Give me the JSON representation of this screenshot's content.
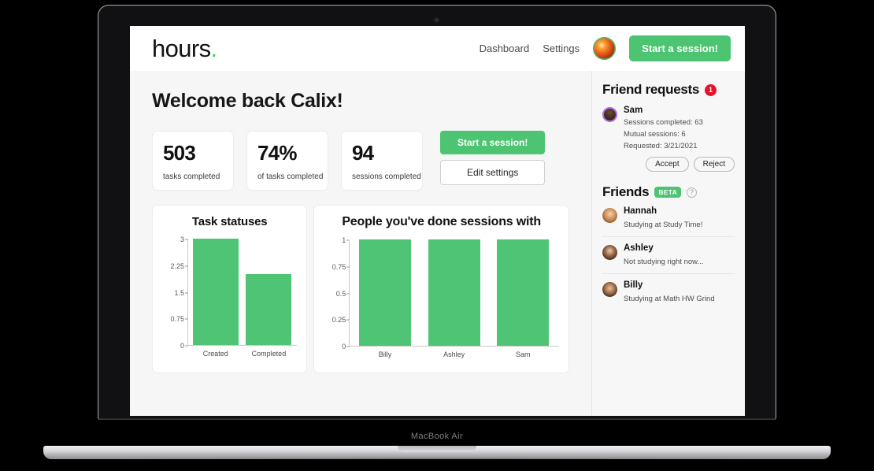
{
  "device": {
    "label": "MacBook Air"
  },
  "header": {
    "logo_text": "hours",
    "logo_dot": ".",
    "nav": [
      {
        "label": "Dashboard"
      },
      {
        "label": "Settings"
      }
    ],
    "avatar_alt": "user-avatar",
    "cta_label": "Start a session!"
  },
  "main": {
    "welcome": "Welcome back Calix!",
    "stats": [
      {
        "value": "503",
        "label": "tasks completed"
      },
      {
        "value": "74%",
        "label": "of tasks completed"
      },
      {
        "value": "94",
        "label": "sessions completed"
      }
    ],
    "actions": {
      "primary": "Start a session!",
      "secondary": "Edit settings"
    }
  },
  "chart_data": [
    {
      "type": "bar",
      "title": "Task statuses",
      "categories": [
        "Created",
        "Completed"
      ],
      "values": [
        3,
        2
      ],
      "yticks": [
        "0",
        "0.75",
        "1.5",
        "2.25",
        "3"
      ],
      "ylim": [
        0,
        3
      ],
      "xlabel": "",
      "ylabel": "",
      "grid": false,
      "legend": "none",
      "bar_color": "#4FC474"
    },
    {
      "type": "bar",
      "title": "People you've done sessions with",
      "categories": [
        "Billy",
        "Ashley",
        "Sam"
      ],
      "values": [
        1,
        1,
        1
      ],
      "yticks": [
        "0",
        "0.25",
        "0.5",
        "0.75",
        "1"
      ],
      "ylim": [
        0,
        1
      ],
      "xlabel": "",
      "ylabel": "",
      "grid": false,
      "legend": "none",
      "bar_color": "#4FC474"
    }
  ],
  "sidebar": {
    "friend_requests": {
      "title": "Friend requests",
      "count": "1",
      "items": [
        {
          "name": "Sam",
          "sessions": "Sessions completed: 63",
          "mutual": "Mutual sessions: 6",
          "requested": "Requested: 3/21/2021",
          "accept": "Accept",
          "reject": "Reject"
        }
      ]
    },
    "friends": {
      "title": "Friends",
      "beta_label": "BETA",
      "help_glyph": "?",
      "items": [
        {
          "name": "Hannah",
          "status": "Studying at Study Time!"
        },
        {
          "name": "Ashley",
          "status": "Not studying right now..."
        },
        {
          "name": "Billy",
          "status": "Studying at Math HW Grind"
        }
      ]
    }
  },
  "colors": {
    "accent_green": "#4CC471",
    "badge_red": "#e8112d",
    "bar_green": "#4FC474"
  }
}
